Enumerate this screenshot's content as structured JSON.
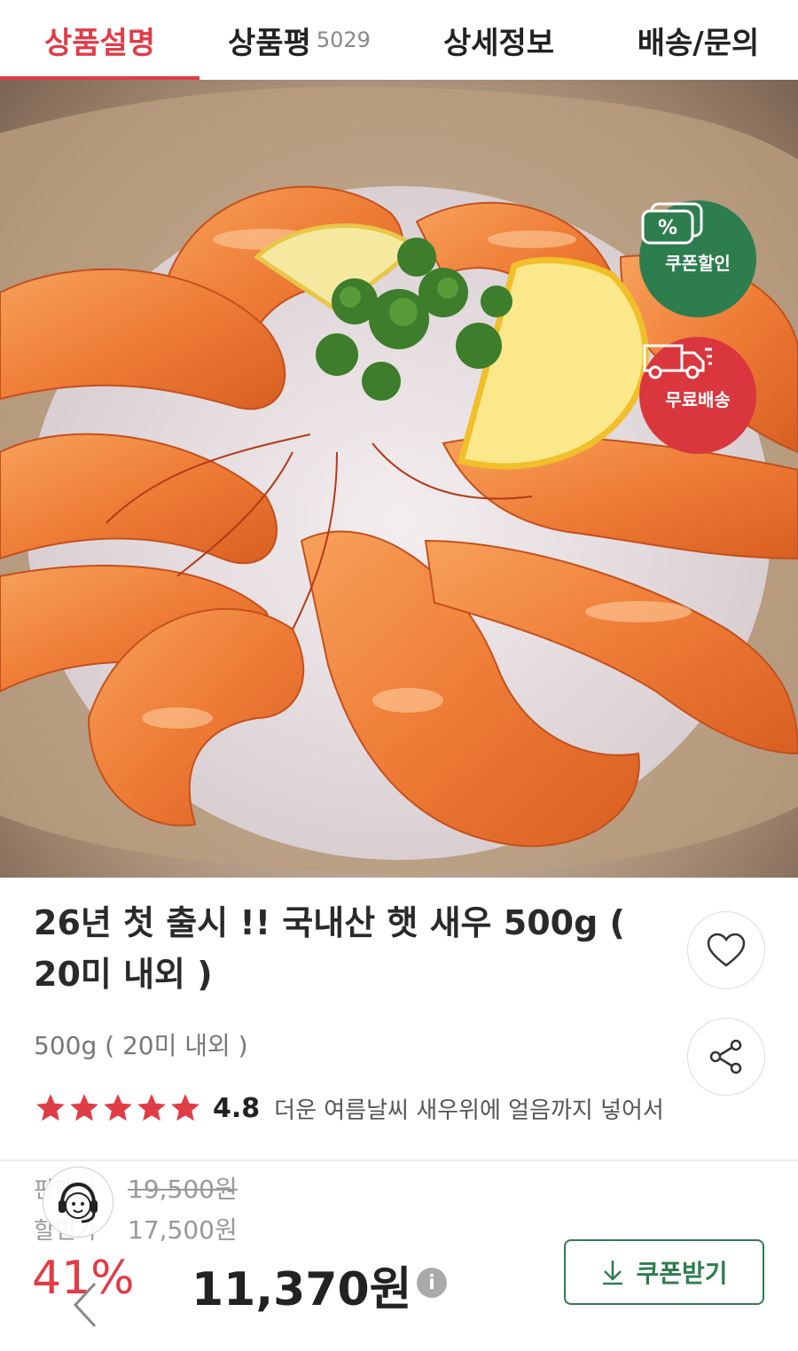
{
  "tabs": [
    {
      "label": "상품설명",
      "count": ""
    },
    {
      "label": "상품평",
      "count": "5029"
    },
    {
      "label": "상세정보",
      "count": ""
    },
    {
      "label": "배송/문의",
      "count": ""
    }
  ],
  "badges": {
    "coupon": {
      "label": "쿠폰할인",
      "symbol": "%",
      "color": "#2e7d4f"
    },
    "shipping": {
      "label": "무료배송",
      "color": "#d9363e"
    }
  },
  "product": {
    "title": "26년 첫 출시 !! 국내산 햇 새우 500g ( 20미 내외 )",
    "subtitle": "500g ( 20미 내외 )",
    "rating": "4.8",
    "stars": 5,
    "review_snippet": "더운 여름날씨 새우위에 얼음까지 넣어서"
  },
  "price": {
    "original_label": "판매가",
    "original": "19,500원",
    "discount_label": "할인가",
    "discounted": "17,500원",
    "percent": "41%",
    "final": "11,370원",
    "info_symbol": "i"
  },
  "coupon_button": {
    "label": "쿠폰받기"
  },
  "colors": {
    "accent": "#e03c46",
    "green": "#2e7d4f"
  }
}
